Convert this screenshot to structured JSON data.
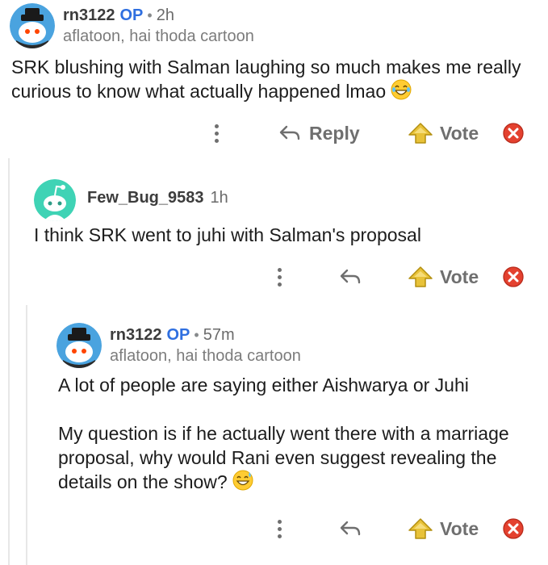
{
  "comments": [
    {
      "username": "rn3122",
      "op_badge": "OP",
      "separator": "•",
      "time": "2h",
      "flair": "aflatoon, hai thoda cartoon",
      "body": [
        "SRK blushing with Salman laughing so much makes me really curious to know what actually happened lmao"
      ],
      "emoji": "laughing-emoji",
      "actions": {
        "reply_label": "Reply",
        "vote_label": "Vote"
      }
    },
    {
      "username": "Few_Bug_9583",
      "time": "1h",
      "body": [
        "I think SRK went to juhi with Salman's proposal"
      ],
      "actions": {
        "vote_label": "Vote"
      }
    },
    {
      "username": "rn3122",
      "op_badge": "OP",
      "separator": "•",
      "time": "57m",
      "flair": "aflatoon, hai thoda cartoon",
      "body": [
        "A lot of people are saying either Aishwarya or Juhi",
        "My question is if he actually went there with a marriage proposal, why would Rani even suggest revealing the details on the show?"
      ],
      "emoji": "sweat-smile-emoji",
      "actions": {
        "vote_label": "Vote"
      }
    }
  ],
  "colors": {
    "op": "#2f6fe0",
    "action_gray": "#6f6f6f",
    "thread_line": "#e7e7e7",
    "vote_yellow": "#e8c239",
    "vote_red": "#e4412f",
    "avatar_teal": "#3fd3b5"
  }
}
